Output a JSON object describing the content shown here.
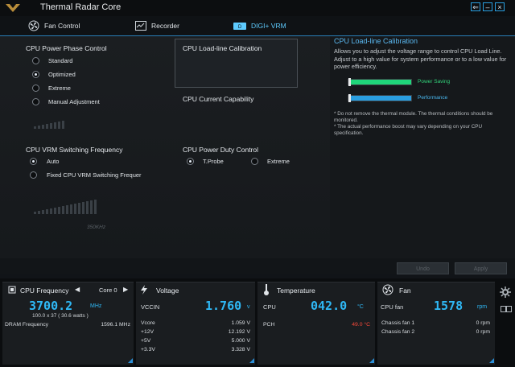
{
  "app": {
    "title": "Thermal Radar Core",
    "logo_text": "THE ULTIMATE FORCE"
  },
  "tabs": [
    {
      "label": "Fan Control"
    },
    {
      "label": "Recorder"
    },
    {
      "label": "DIGI+ VRM"
    }
  ],
  "left": {
    "phase_control": {
      "title": "CPU Power Phase Control",
      "options": [
        "Standard",
        "Optimized",
        "Extreme",
        "Manual Adjustment"
      ],
      "selected": 1
    },
    "switching_freq": {
      "title": "CPU VRM Switching Frequency",
      "options": [
        "Auto",
        "Fixed CPU VRM Switching Frequer"
      ],
      "selected": 0,
      "slider_value": "350KHz"
    },
    "llc": {
      "title": "CPU Load-line Calibration"
    },
    "current_capability": {
      "title": "CPU Current Capability"
    },
    "duty_control": {
      "title": "CPU Power Duty Control",
      "options": [
        "T.Probe",
        "Extreme"
      ],
      "selected": 0
    }
  },
  "right": {
    "title": "CPU Load-line Calibration",
    "description": "Allows you to adjust the voltage range to control CPU Load Line. Adjust to a high value for system performance or to a low value for power efficiency.",
    "bars": [
      {
        "label": "Power Saving",
        "color": "#1fd67a",
        "fill": 1.0
      },
      {
        "label": "Performance",
        "color": "#2a9ee0",
        "fill": 1.0
      }
    ],
    "notes": [
      "Do not remove the thermal module. The thermal conditions should be monitored.",
      "The actual performance boost may vary depending on your CPU specification."
    ]
  },
  "buttons": {
    "undo": "Undo",
    "apply": "Apply"
  },
  "cards": {
    "cpu_freq": {
      "title": "CPU Frequency",
      "core_label": "Core 0",
      "value": "3700.2",
      "unit": "MHz",
      "sub": "100.0  x  37   ( 30.6    watts )",
      "dram_label": "DRAM Frequency",
      "dram_value": "1596.1  MHz"
    },
    "voltage": {
      "title": "Voltage",
      "main_label": "VCCIN",
      "main_value": "1.760",
      "main_unit": "v",
      "rows": [
        {
          "label": "Vcore",
          "value": "1.059  V"
        },
        {
          "label": "+12V",
          "value": "12.192  V"
        },
        {
          "label": "+5V",
          "value": "5.000  V"
        },
        {
          "label": "+3.3V",
          "value": "3.328  V"
        }
      ]
    },
    "temperature": {
      "title": "Temperature",
      "main_label": "CPU",
      "main_value": "042.0",
      "main_unit": "°C",
      "rows": [
        {
          "label": "PCH",
          "value": "49.0 °C",
          "color": "#ff4a3a"
        }
      ]
    },
    "fan": {
      "title": "Fan",
      "main_label": "CPU fan",
      "main_value": "1578",
      "main_unit": "rpm",
      "rows": [
        {
          "label": "Chassis fan 1",
          "value": "0  rpm"
        },
        {
          "label": "Chassis fan 2",
          "value": "0  rpm"
        }
      ]
    }
  },
  "accent": "#2fb8f5"
}
